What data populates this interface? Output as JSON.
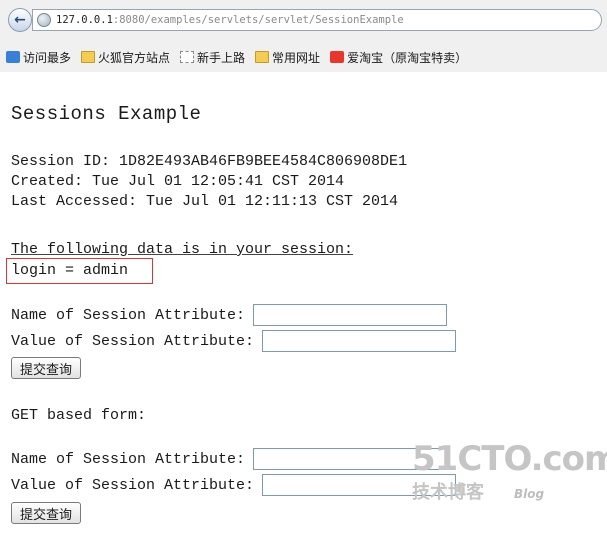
{
  "browser": {
    "url_host": "127.0.0.1",
    "url_rest": ":8080/examples/servlets/servlet/SessionExample",
    "bookmarks": [
      {
        "label": "访问最多",
        "icon": "search-bookmark-icon"
      },
      {
        "label": "火狐官方站点",
        "icon": "folder-icon"
      },
      {
        "label": "新手上路",
        "icon": "blank-page-icon"
      },
      {
        "label": "常用网址",
        "icon": "folder-icon"
      },
      {
        "label": "爱淘宝（原淘宝特卖）",
        "icon": "taobao-icon"
      }
    ]
  },
  "page": {
    "title": "Sessions Example",
    "session_id": "Session ID: 1D82E493AB46FB9BEE4584C806908DE1",
    "created": "Created: Tue Jul 01 12:05:41 CST 2014",
    "last_accessed": "Last Accessed: Tue Jul 01 12:11:13 CST 2014",
    "data_intro": "The following data is in your session:",
    "attribute_line": "login = admin",
    "form1": {
      "name_label": "Name of Session Attribute:",
      "value_label": "Value of Session Attribute:",
      "name_value": "",
      "value_value": "",
      "submit_label": "提交查询"
    },
    "get_heading": "GET based form:",
    "form2": {
      "name_label": "Name of Session Attribute:",
      "value_label": "Value of Session Attribute:",
      "name_value": "",
      "value_value": "",
      "submit_label": "提交查询"
    }
  },
  "watermark": {
    "main": "51CTO.com",
    "sub": "技术博客",
    "blog": "Blog"
  },
  "colors": {
    "highlight_border": "#dd3333",
    "input_border": "#7d99b8",
    "watermark": "#c5c5c5"
  }
}
